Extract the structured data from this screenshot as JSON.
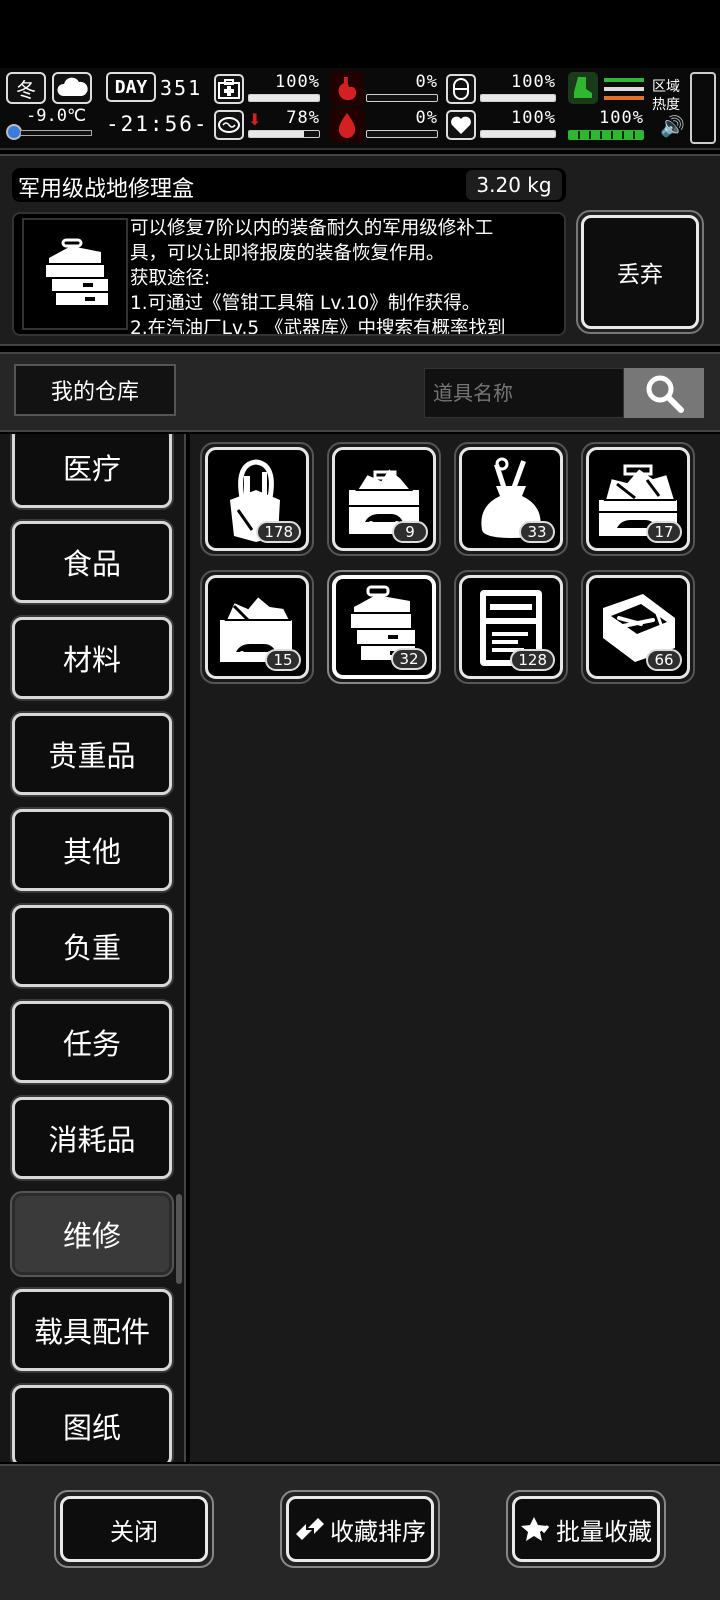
{
  "status_bar": {
    "season": "冬",
    "temperature": "-9.0℃",
    "day_label": "DAY",
    "day_number": "351",
    "clock": "-21:56-",
    "stats": [
      {
        "id": "health",
        "icon": "medkit-icon",
        "value": "100%",
        "level": 1.0
      },
      {
        "id": "hunger",
        "icon": "stomach-icon",
        "value": "0%",
        "level": 0.0
      },
      {
        "id": "stamina",
        "icon": "lungs-icon",
        "value": "100%",
        "level": 1.0
      },
      {
        "id": "mood",
        "icon": "brain-icon",
        "value": "78%",
        "level": 0.78
      },
      {
        "id": "thirst",
        "icon": "blood-drop-icon",
        "value": "0%",
        "level": 0.0
      },
      {
        "id": "heart",
        "icon": "heart-icon",
        "value": "100%",
        "level": 1.0
      }
    ],
    "load_value": "100%",
    "load_level": 1.0,
    "zone_heat_label": "区域\n热度",
    "colors": {
      "red_icon": "#d42020",
      "green": "#2fb82f",
      "orange": "#e0702a"
    }
  },
  "item_detail": {
    "name": "军用级战地修理盒",
    "weight": "3.20 kg",
    "description": "可以修复7阶以内的装备耐久的军用级修补工具，可以让即将报废的装备恢复作用。\n获取途径:\n1.可通过《管钳工具箱 Lv.10》制作获得。\n2.在汽油厂Lv.5 《武器库》中搜索有概率找到",
    "discard_label": "丢弃"
  },
  "storage": {
    "title": "我的仓库",
    "search_placeholder": "道具名称"
  },
  "categories": [
    {
      "label": "医疗",
      "active": false
    },
    {
      "label": "食品",
      "active": false
    },
    {
      "label": "材料",
      "active": false
    },
    {
      "label": "贵重品",
      "active": false
    },
    {
      "label": "其他",
      "active": false
    },
    {
      "label": "负重",
      "active": false
    },
    {
      "label": "任务",
      "active": false
    },
    {
      "label": "消耗品",
      "active": false
    },
    {
      "label": "维修",
      "active": true
    },
    {
      "label": "载具配件",
      "active": false
    },
    {
      "label": "图纸",
      "active": false
    }
  ],
  "items": [
    {
      "icon": "tool-bag-icon",
      "count": "178",
      "selected": false
    },
    {
      "icon": "toolbox-car-icon",
      "count": "9",
      "selected": false
    },
    {
      "icon": "tool-sack-icon",
      "count": "33",
      "selected": false
    },
    {
      "icon": "large-toolbox-icon",
      "count": "17",
      "selected": false
    },
    {
      "icon": "toolbox-car-small-icon",
      "count": "15",
      "selected": false
    },
    {
      "icon": "military-repair-box-icon",
      "count": "32",
      "selected": true
    },
    {
      "icon": "tool-case-icon",
      "count": "128",
      "selected": false
    },
    {
      "icon": "pliers-box-icon",
      "count": "66",
      "selected": false
    }
  ],
  "footer": {
    "close_label": "关闭",
    "sort_label": "收藏排序",
    "batch_label": "批量收藏"
  }
}
